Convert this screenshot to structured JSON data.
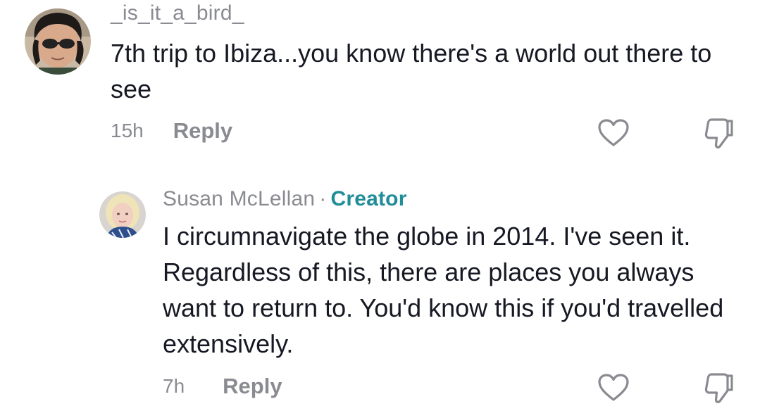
{
  "comments": [
    {
      "username": "_is_it_a_bird_",
      "text": "7th trip to Ibiza...you know there's a world out there to see",
      "time": "15h",
      "reply_label": "Reply"
    },
    {
      "username": "Susan McLellan",
      "separator": "·",
      "badge": "Creator",
      "text": "I circumnavigate the globe in 2014. I've seen it. Regardless of this, there are places you always want to return to. You'd know this if you'd travelled extensively.",
      "time": "7h",
      "reply_label": "Reply"
    }
  ],
  "icons": {
    "like": "heart-icon",
    "dislike": "thumbs-down-icon"
  },
  "colors": {
    "text": "#161823",
    "muted": "#8a8b91",
    "creator_badge": "#1f8c98"
  }
}
